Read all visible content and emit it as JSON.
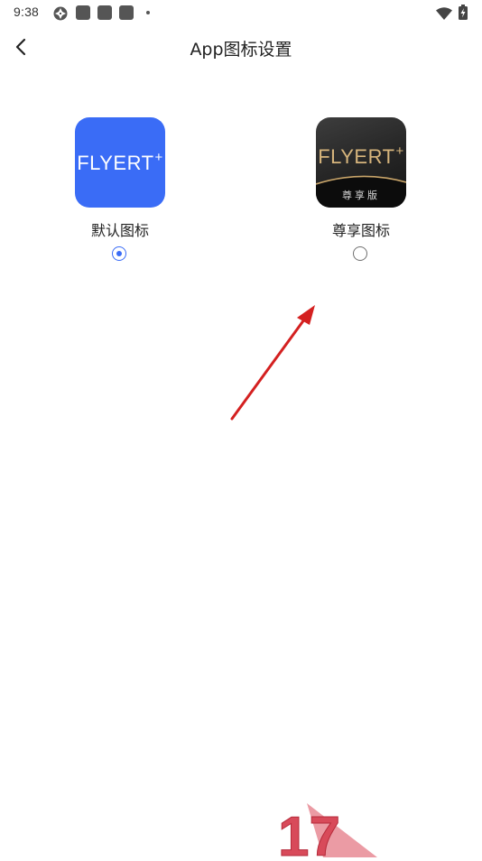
{
  "status_bar": {
    "time": "9:38",
    "icons": [
      "sync-icon",
      "app-notification-icon",
      "app-notification-icon",
      "app-notification-icon",
      "more-notifications-dot",
      "wifi-icon",
      "battery-charging-icon"
    ]
  },
  "header": {
    "title": "App图标设置",
    "back_icon": "chevron-left-icon"
  },
  "options": [
    {
      "label": "默认图标",
      "icon_text": "FLYERT",
      "icon_superscript": "+",
      "icon_color": "#3a6cf6",
      "selected": true
    },
    {
      "label": "尊享图标",
      "icon_text": "FLYERT",
      "icon_superscript": "+",
      "icon_badge": "尊享版",
      "icon_color": "#242424",
      "accent_color": "#d7b57c",
      "selected": false
    }
  ],
  "watermark": {
    "text": "17"
  },
  "colors": {
    "accent": "#3a6cf6",
    "annotation": "#d42020",
    "background": "#ffffff"
  }
}
